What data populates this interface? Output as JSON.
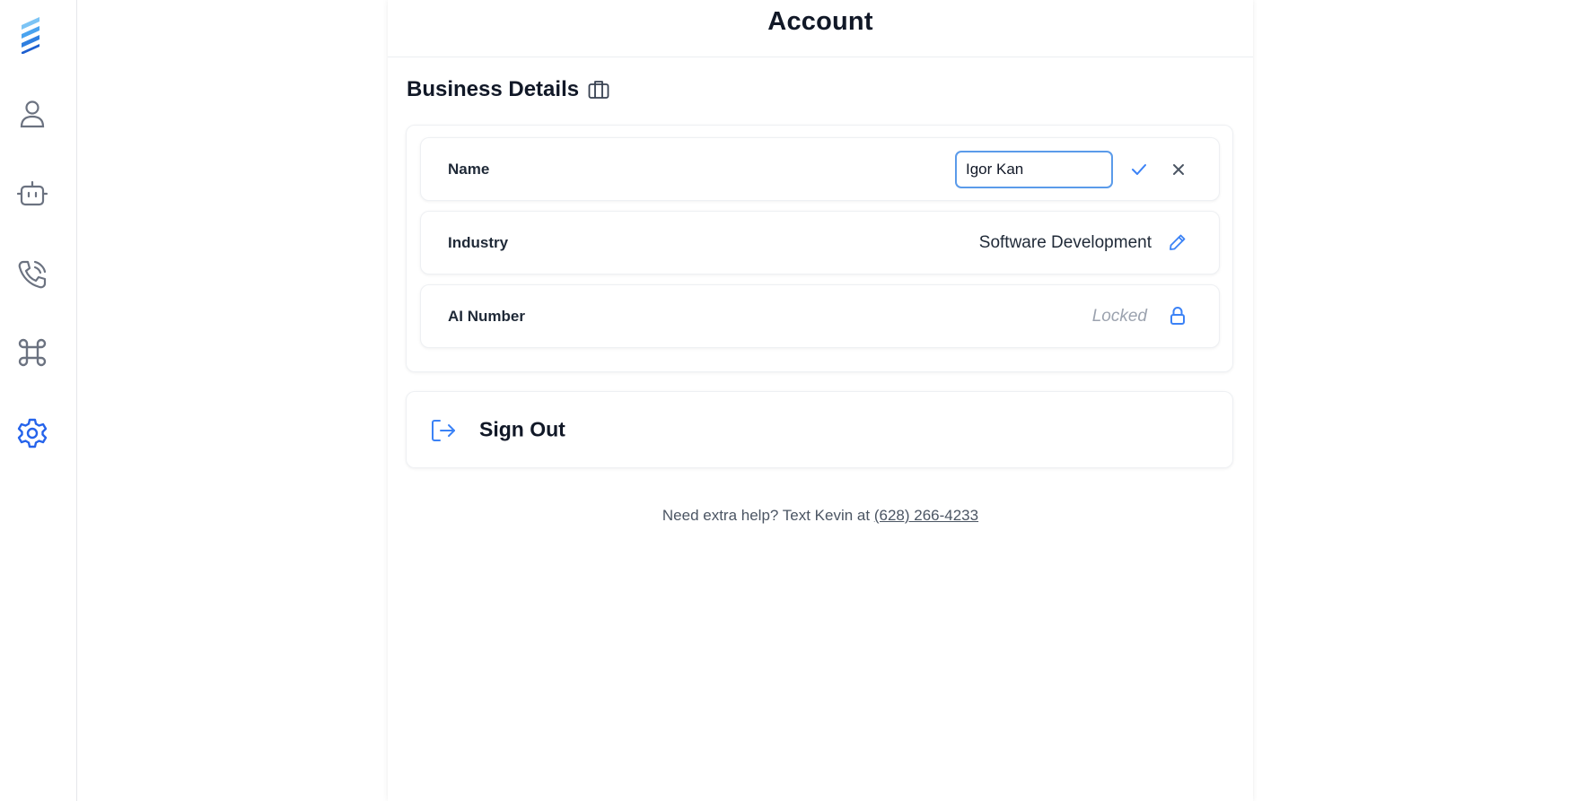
{
  "sidebar": {
    "items": [
      {
        "icon": "user-icon",
        "active": false
      },
      {
        "icon": "bot-icon",
        "active": false
      },
      {
        "icon": "phone-call-icon",
        "active": false
      },
      {
        "icon": "command-icon",
        "active": false
      },
      {
        "icon": "gear-icon",
        "active": true
      }
    ]
  },
  "header": {
    "title": "Account"
  },
  "business_details": {
    "title": "Business Details",
    "icon": "briefcase-icon",
    "rows": [
      {
        "label": "Name",
        "value": "Igor Kan",
        "mode": "editing"
      },
      {
        "label": "Industry",
        "value": "Software Development",
        "mode": "view"
      },
      {
        "label": "AI Number",
        "value": "Locked",
        "mode": "locked"
      }
    ]
  },
  "sign_out": {
    "label": "Sign Out",
    "icon": "sign-out-icon"
  },
  "help": {
    "text": "Need extra help? Text Kevin at ",
    "phone": "(628) 266-4233"
  },
  "colors": {
    "accent": "#3b82f6",
    "active_nav": "#2563eb",
    "icon_gray": "#6b7280",
    "locked_text": "#9ca3af"
  }
}
